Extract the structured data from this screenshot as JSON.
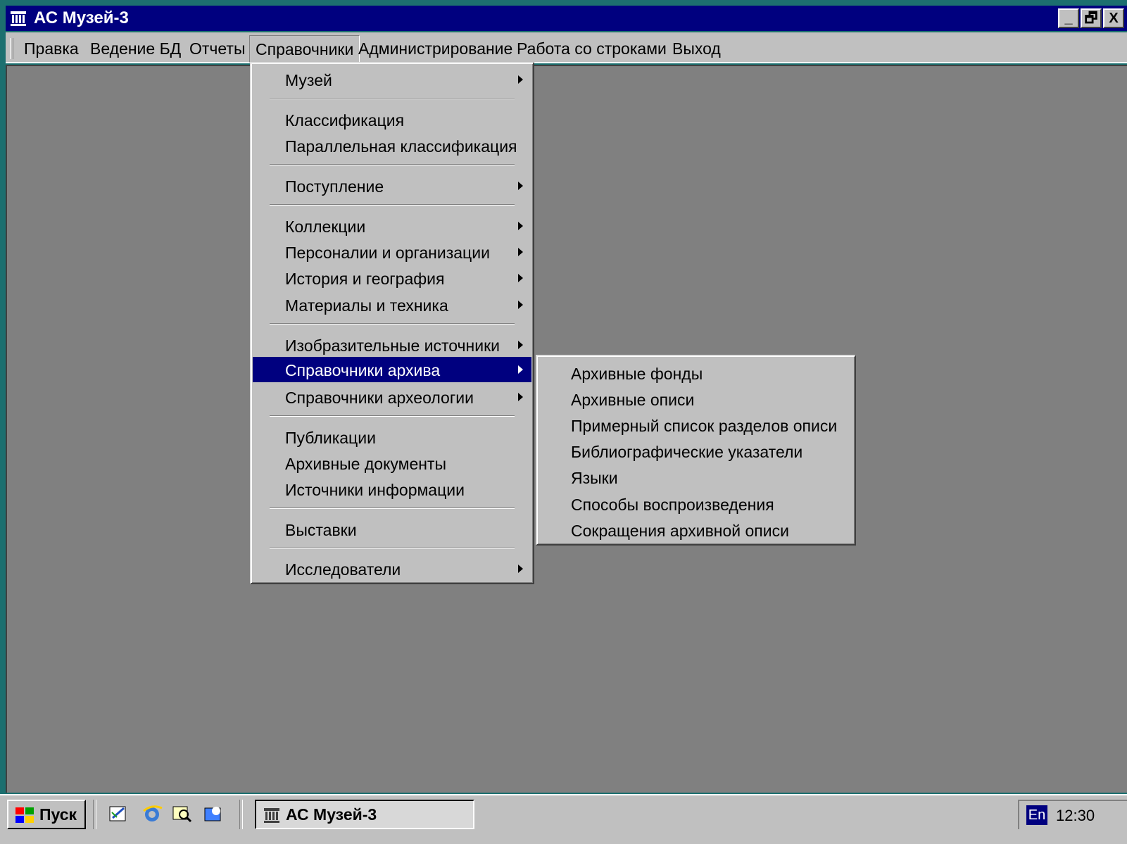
{
  "window": {
    "title": "АС Музей-3",
    "buttons": [
      "_",
      "🗗",
      "X"
    ]
  },
  "menubar": {
    "items": [
      "Правка",
      "Ведение БД",
      "Отчеты",
      "Справочники",
      "Администрирование",
      "Работа со строками",
      "Выход"
    ],
    "open_index": 3
  },
  "main_menu": {
    "items": [
      {
        "label": "Музей",
        "submenu": true
      },
      {
        "label": "Классификация",
        "submenu": false
      },
      {
        "label": "Параллельная классификация",
        "submenu": false
      },
      {
        "label": "Поступление",
        "submenu": true
      },
      {
        "label": "Коллекции",
        "submenu": true
      },
      {
        "label": "Персоналии и организации",
        "submenu": true
      },
      {
        "label": "История и география",
        "submenu": true
      },
      {
        "label": "Материалы и техника",
        "submenu": true
      },
      {
        "label": "Изобразительные источники",
        "submenu": true
      },
      {
        "label": "Справочники архива",
        "submenu": true,
        "highlighted": true
      },
      {
        "label": "Справочники археологии",
        "submenu": true
      },
      {
        "label": "Публикации",
        "submenu": false
      },
      {
        "label": "Архивные документы",
        "submenu": false
      },
      {
        "label": "Источники информации",
        "submenu": false
      },
      {
        "label": "Выставки",
        "submenu": false
      },
      {
        "label": "Исследователи",
        "submenu": true
      }
    ]
  },
  "sub_menu": {
    "items": [
      "Архивные фонды",
      "Архивные описи",
      "Примерный список разделов описи",
      "Библиографические указатели",
      "Языки",
      "Способы воспроизведения",
      "Сокращения архивной описи"
    ]
  },
  "taskbar": {
    "start_label": "Пуск",
    "quick_launch_icons": [
      "outlook-express-icon",
      "internet-explorer-icon",
      "find-icon",
      "channels-icon"
    ],
    "task_title": "АС Музей-3",
    "language": "En",
    "clock": "12:30"
  },
  "colors": {
    "titlebar": "#00007f",
    "highlight": "#00007f",
    "face": "#c0c0c0",
    "workspace": "#808080",
    "desktop": "#1c6f6f"
  }
}
